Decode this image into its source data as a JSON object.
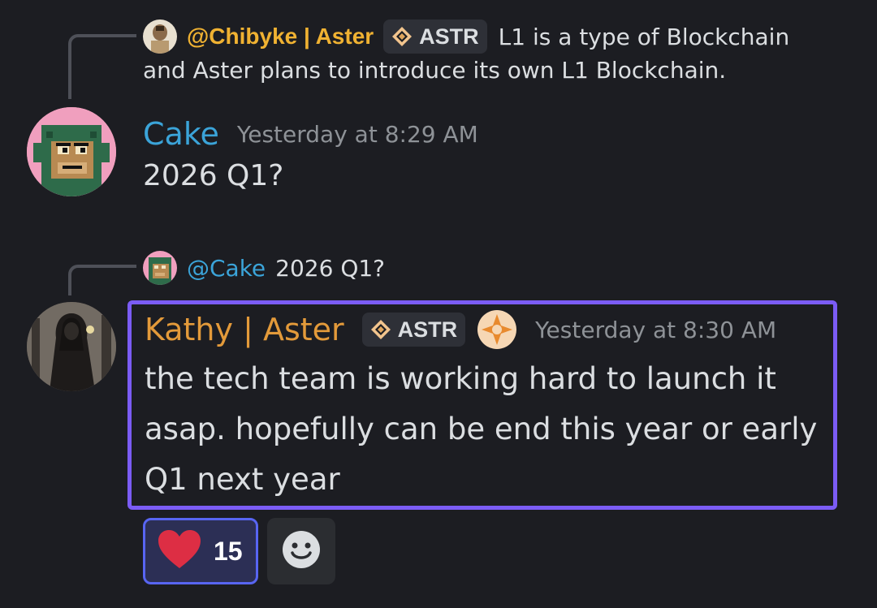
{
  "reply1": {
    "author": "@Chibyke | Aster",
    "tag": "ASTR",
    "text_line1": "L1 is a type of Blockchain",
    "text_line2": "and Aster plans to introduce its own L1 Blockchain."
  },
  "message1": {
    "author": "Cake",
    "timestamp": "Yesterday at 8:29 AM",
    "content": "2026 Q1?"
  },
  "reply2": {
    "author": "@Cake",
    "text": "2026 Q1?"
  },
  "message2": {
    "author": "Kathy | Aster",
    "tag": "ASTR",
    "timestamp": "Yesterday at 8:30 AM",
    "content": "the tech team is working hard to launch it asap. hopefully can be end this year or early Q1 next year"
  },
  "reactions": [
    {
      "emoji": "heart",
      "count": "15"
    },
    {
      "emoji": "add-reaction"
    }
  ],
  "colors": {
    "background": "#1c1d22",
    "cake_name": "#3ba4d9",
    "aster_name": "#e39a3a",
    "highlight_border": "#7b5cf5",
    "reaction_active": "#5865f2"
  }
}
